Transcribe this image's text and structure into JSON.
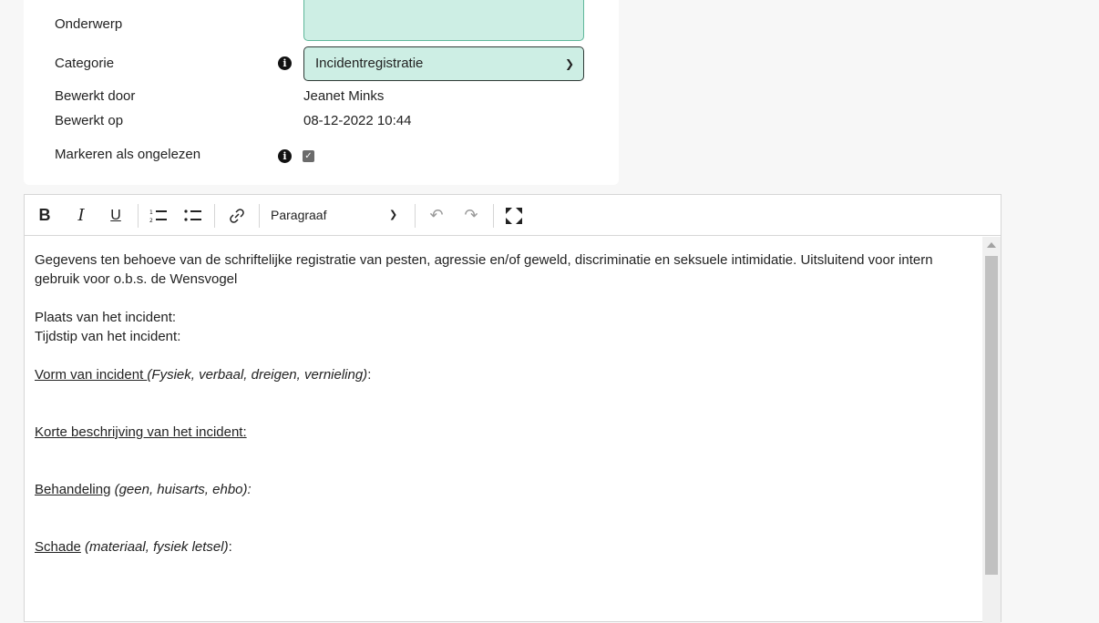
{
  "form": {
    "subject_label": "Onderwerp",
    "subject_value": "",
    "category_label": "Categorie",
    "category_value": "Incidentregistratie",
    "edited_by_label": "Bewerkt door",
    "edited_by_value": "Jeanet Minks",
    "edited_on_label": "Bewerkt op",
    "edited_on_value": "08-12-2022 10:44",
    "mark_unread_label": "Markeren als ongelezen",
    "mark_unread_checked": true,
    "info_icon": "info-icon"
  },
  "toolbar": {
    "bold": "B",
    "italic": "I",
    "underline": "U",
    "numbered_list": "numbered-list-icon",
    "bullet_list": "bullet-list-icon",
    "link": "link-icon",
    "paragraph_select": "Paragraaf",
    "undo": "undo-icon",
    "redo": "redo-icon",
    "fullscreen": "fullscreen-icon"
  },
  "content": {
    "intro": "Gegevens ten behoeve van de schriftelijke registratie van pesten, agressie en/of geweld, discriminatie en seksuele intimidatie. Uitsluitend voor intern gebruik voor o.b.s. de Wensvogel",
    "place": "Plaats van het incident:",
    "time": "Tijdstip van het incident:",
    "form_label": "Vorm van incident ",
    "form_hint": "(Fysiek, verbaal, dreigen, vernieling)",
    "form_colon": ":",
    "description_label": "Korte beschrijving van het incident: ",
    "treatment_label": "Behandeling",
    "treatment_hint": " (geen, huisarts, ehbo):",
    "damage_label": "Schade",
    "damage_hint": " (materiaal, fysiek letsel)",
    "damage_colon": ":"
  },
  "colors": {
    "accent_field": "#cdeee4",
    "border": "#d6d6d6"
  }
}
